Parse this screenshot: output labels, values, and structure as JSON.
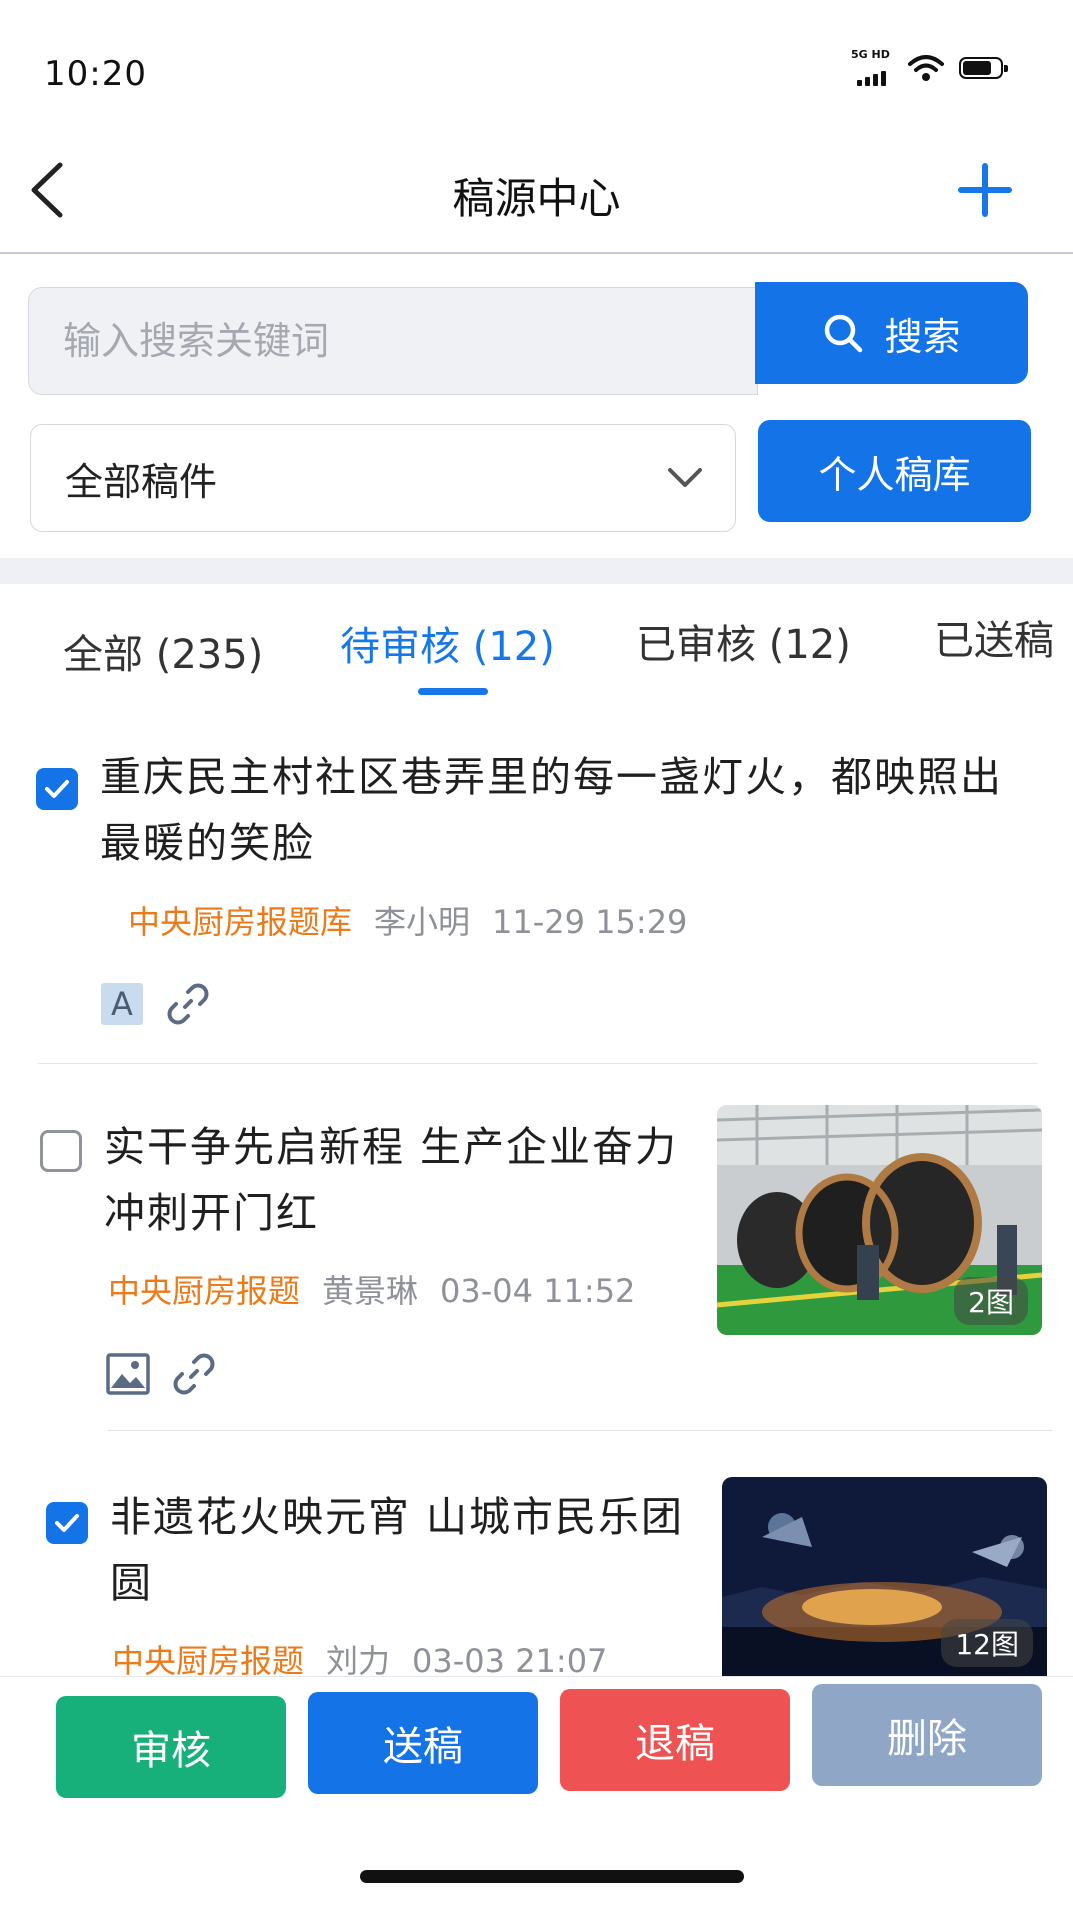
{
  "status_bar": {
    "time": "10:20",
    "network": "5G HD",
    "icons": [
      "signal-icon",
      "wifi-icon",
      "battery-icon"
    ]
  },
  "nav": {
    "title": "稿源中心",
    "back_icon": "chevron-left-icon",
    "add_icon": "plus-icon"
  },
  "search": {
    "placeholder": "输入搜索关键词",
    "value": "",
    "button_label": "搜索"
  },
  "filter": {
    "selected": "全部稿件",
    "personal_library_label": "个人稿库"
  },
  "tabs": [
    {
      "label": "全部 (235)",
      "active": false
    },
    {
      "label": "待审核 (12)",
      "active": true
    },
    {
      "label": "已审核 (12)",
      "active": false
    },
    {
      "label": "已送稿",
      "active": false
    }
  ],
  "articles": [
    {
      "title": "重庆民主村社区巷弄里的每一盏灯火，都映照出最暖的笑脸",
      "source": "中央厨房报题库",
      "author": "李小明",
      "time": "11-29 15:29",
      "checked": true,
      "type_badge": "A",
      "has_link": true
    },
    {
      "title": "实干争先启新程 生产企业奋力冲刺开门红",
      "source": "中央厨房报题",
      "author": "黄景琳",
      "time": "03-04 11:52",
      "checked": false,
      "has_image": true,
      "has_link": true,
      "image_count": "2图"
    },
    {
      "title": "非遗花火映元宵 山城市民乐团圆",
      "source": "中央厨房报题",
      "author": "刘力",
      "time": "03-03 21:07",
      "checked": true,
      "image_count": "12图"
    }
  ],
  "actions": [
    {
      "label": "审核",
      "color": "#17b07a"
    },
    {
      "label": "送稿",
      "color": "#1473e6"
    },
    {
      "label": "退稿",
      "color": "#ee5252"
    },
    {
      "label": "删除",
      "color": "#8fa6c6"
    }
  ],
  "colors": {
    "primary": "#1473e6",
    "source_orange": "#ea7a1a",
    "meta_gray": "#8e9199"
  }
}
